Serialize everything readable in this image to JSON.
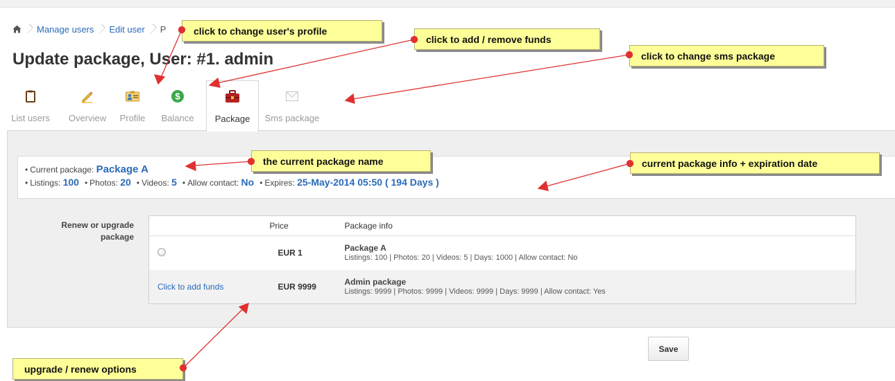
{
  "breadcrumb": {
    "home_icon": "home-icon",
    "items": [
      "Manage users",
      "Edit user"
    ],
    "current": "P"
  },
  "page_title": "Update package, User: #1. admin",
  "tabs": [
    {
      "label": "List users",
      "icon": "clipboard-icon"
    },
    {
      "label": "Overview",
      "icon": "pencil-icon"
    },
    {
      "label": "Profile",
      "icon": "id-card-icon"
    },
    {
      "label": "Balance",
      "icon": "dollar-coin-icon"
    },
    {
      "label": "Package",
      "icon": "briefcase-icon",
      "active": true
    },
    {
      "label": "Sms package",
      "icon": "envelope-icon"
    }
  ],
  "current_package": {
    "current_label": "Current package:",
    "current_value": "Package A",
    "listings_label": "Listings:",
    "listings_value": "100",
    "photos_label": "Photos:",
    "photos_value": "20",
    "videos_label": "Videos:",
    "videos_value": "5",
    "contact_label": "Allow contact:",
    "contact_value": "No",
    "expires_label": "Expires:",
    "expires_value": "25-May-2014 05:50 ( 194 Days )"
  },
  "renew": {
    "label_line1": "Renew or upgrade",
    "label_line2": "package",
    "headers": {
      "price": "Price",
      "info": "Package info"
    },
    "rows": [
      {
        "action": "radio",
        "price": "EUR 1",
        "name": "Package A",
        "details": "Listings: 100 | Photos: 20 | Videos: 5 | Days: 1000 | Allow contact: No"
      },
      {
        "action": "Click to add funds",
        "price": "EUR 9999",
        "name": "Admin package",
        "details": "Listings: 9999 | Photos: 9999 | Videos: 9999 | Days: 9999 | Allow contact: Yes"
      }
    ]
  },
  "save_label": "Save",
  "callouts": {
    "profile": "click to change user's profile",
    "funds": "click to add / remove funds",
    "sms": "click to change sms package",
    "pkg_name": "the current package name",
    "pkg_info": "current package info + expiration date",
    "upgrade": "upgrade / renew options"
  },
  "colors": {
    "link": "#2a6ab8",
    "callout_bg": "#ffff99",
    "arrow": "#e03030"
  }
}
